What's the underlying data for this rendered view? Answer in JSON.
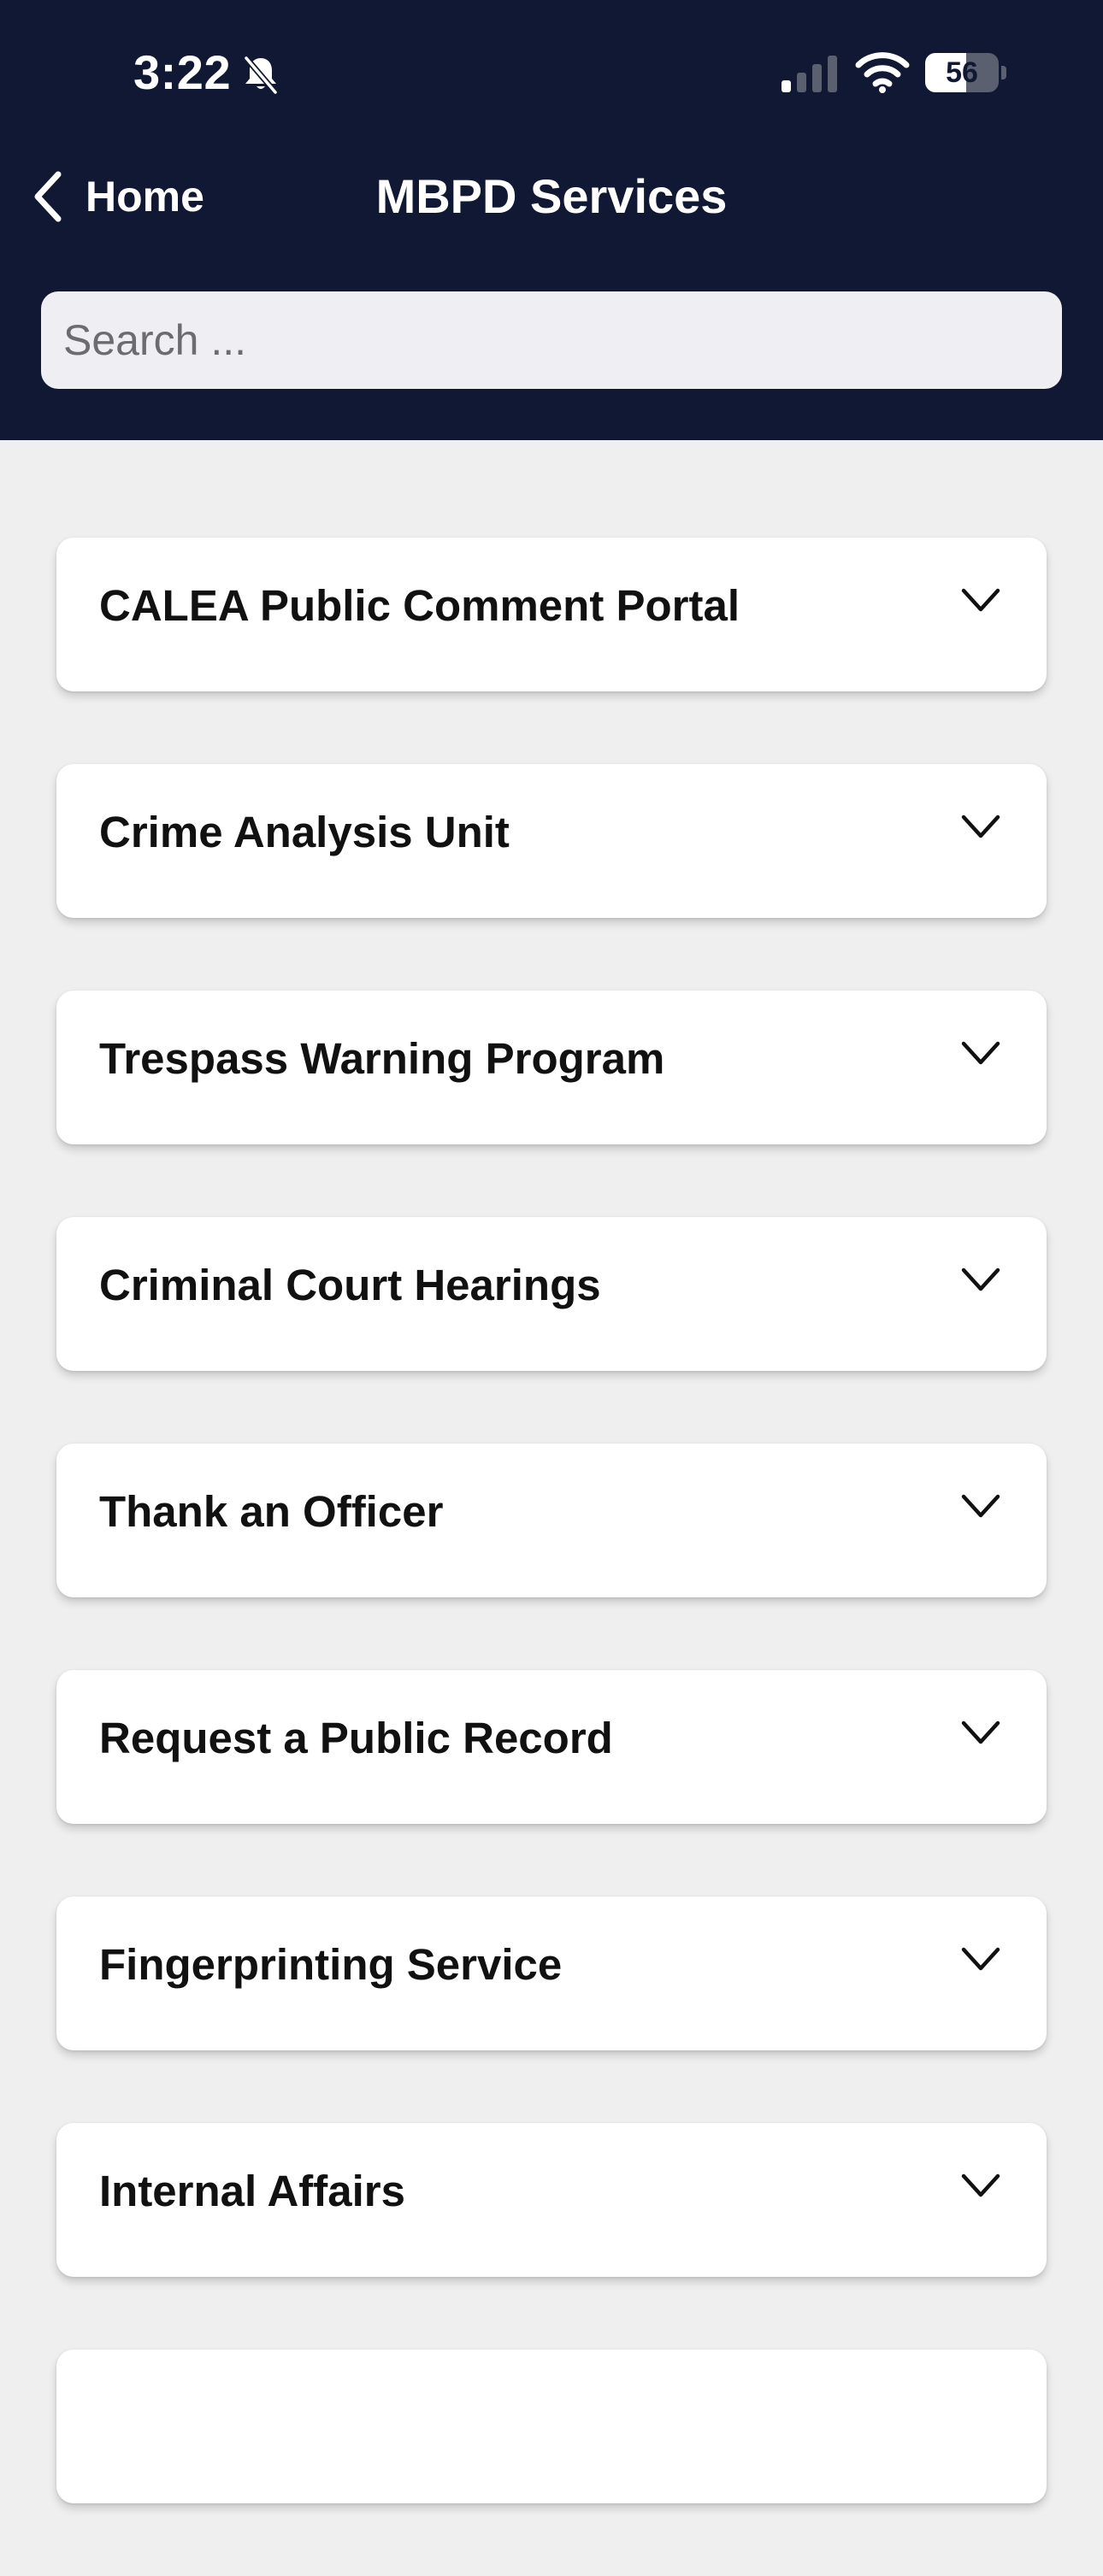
{
  "status_bar": {
    "time": "3:22",
    "battery_level": "56",
    "battery_fraction": 0.56,
    "icons": [
      "bell-slash-icon",
      "cellular-signal-icon",
      "wifi-icon",
      "battery-icon"
    ]
  },
  "nav": {
    "back_label": "Home",
    "title": "MBPD Services",
    "back_icon": "chevron-left-icon"
  },
  "search": {
    "placeholder": "Search ...",
    "value": ""
  },
  "services": [
    {
      "label": "CALEA Public Comment Portal"
    },
    {
      "label": "Crime Analysis Unit"
    },
    {
      "label": "Trespass Warning Program"
    },
    {
      "label": "Criminal Court Hearings"
    },
    {
      "label": "Thank an Officer"
    },
    {
      "label": "Request a Public Record"
    },
    {
      "label": "Fingerprinting Service"
    },
    {
      "label": "Internal Affairs"
    },
    {
      "label": ""
    }
  ],
  "item_icon": "chevron-down-icon",
  "colors": {
    "header_background": "#101833",
    "page_background": "#efefef",
    "card_background": "#ffffff",
    "search_background": "#eeeef3",
    "text_primary": "#111111",
    "text_on_header": "#ffffff"
  }
}
